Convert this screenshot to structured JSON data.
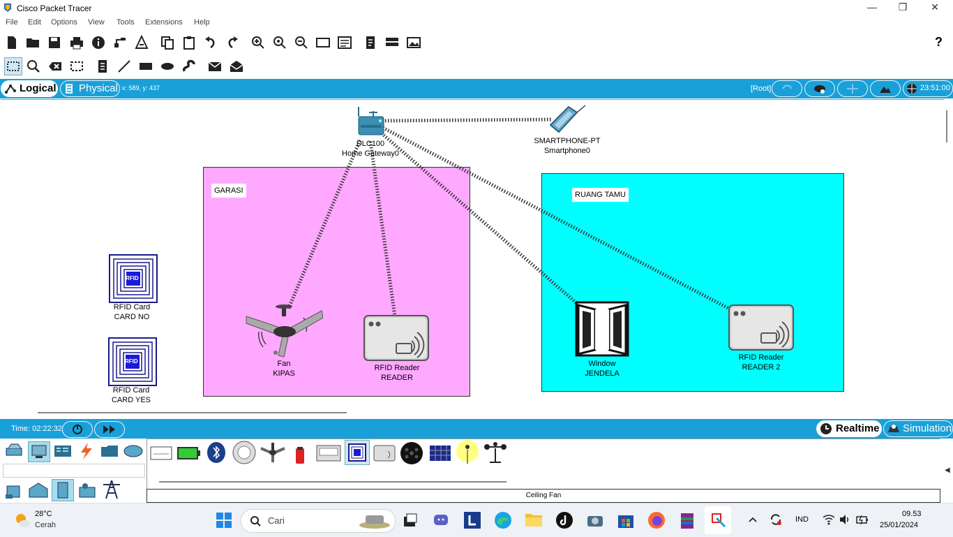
{
  "window": {
    "title": "Cisco Packet Tracer"
  },
  "menu": [
    "File",
    "Edit",
    "Options",
    "View",
    "Tools",
    "Extensions",
    "Help"
  ],
  "toolbar": {
    "help_label": "?"
  },
  "viewbar": {
    "logical_label": "Logical",
    "physical_label": "Physical",
    "coords": "x: 589, y: 437",
    "root_label": "[Root]",
    "clock": "23:51:00"
  },
  "workspace": {
    "clusters": [
      {
        "label": "GARASI",
        "color": "#ffa8ff"
      },
      {
        "label": "RUANG TAMU",
        "color": "#00ffff"
      }
    ],
    "devices": {
      "gateway": {
        "line1": "DLC100",
        "line2": "Home Gateway0"
      },
      "smartphone": {
        "line1": "SMARTPHONE-PT",
        "line2": "Smartphone0"
      },
      "card_no": {
        "line1": "RFID Card",
        "line2": "CARD NO"
      },
      "card_yes": {
        "line1": "RFID Card",
        "line2": "CARD YES"
      },
      "fan": {
        "line1": "Fan",
        "line2": "KIPAS"
      },
      "reader": {
        "line1": "RFID Reader",
        "line2": "READER"
      },
      "window": {
        "line1": "Window",
        "line2": "JENDELA"
      },
      "reader2": {
        "line1": "RFID Reader",
        "line2": "READER 2"
      }
    },
    "rfid_badge": "RFID"
  },
  "simbar": {
    "time": "Time: 02:22:32",
    "realtime_label": "Realtime",
    "simulation_label": "Simulation"
  },
  "device_panel": {
    "selected_name": "Ceiling Fan"
  },
  "taskbar": {
    "weather_temp": "28°C",
    "weather_desc": "Cerah",
    "search_placeholder": "Cari",
    "language": "IND",
    "time": "09.53",
    "date": "25/01/2024"
  },
  "colors": {
    "accent": "#1aa0d8"
  }
}
